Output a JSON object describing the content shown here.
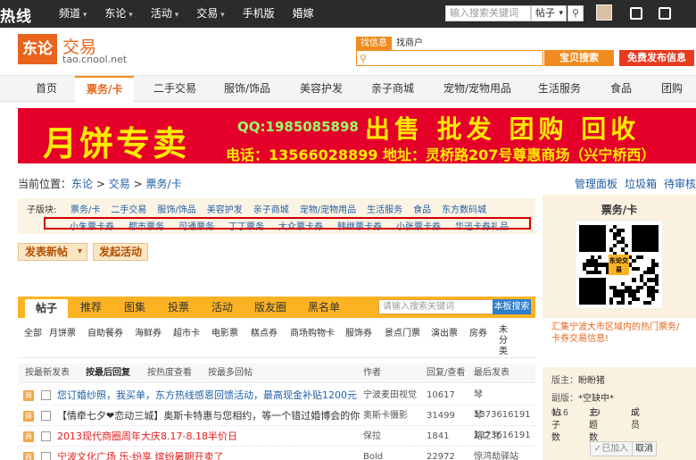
{
  "topbar": {
    "logo": "热线",
    "nav": [
      {
        "label": "频道",
        "dropdown": true
      },
      {
        "label": "东论",
        "dropdown": true
      },
      {
        "label": "活动",
        "dropdown": true
      },
      {
        "label": "交易",
        "dropdown": true
      },
      {
        "label": "手机版",
        "dropdown": false
      },
      {
        "label": "婚嫁",
        "dropdown": false
      }
    ],
    "search_placeholder": "输入搜索关键词",
    "search_type": "帖子"
  },
  "brand": {
    "logo_text": "东论",
    "title": "交易",
    "url": "tao.cnool.net"
  },
  "search": {
    "tabs": [
      "找信息",
      "找商户"
    ],
    "button": "宝贝搜索",
    "post_button": "免费发布信息"
  },
  "mainnav": [
    "首页",
    "票务/卡",
    "二手交易",
    "服饰/饰品",
    "美容护发",
    "亲子商城",
    "宠物/宠物用品",
    "生活服务",
    "食品",
    "团购"
  ],
  "banner": {
    "headline": "月饼专卖",
    "qq": "QQ:1985085898",
    "slogan": "出售 批发 团购 回收",
    "contact": "电话：13566028899 地址：灵桥路207号尊惠商场（兴宁桥西）"
  },
  "breadcrumb": {
    "prefix": "当前位置：",
    "items": [
      "东论",
      "交易",
      "票务/卡"
    ],
    "sep": ">"
  },
  "tools": [
    "管理面板",
    "垃圾箱",
    "待审核"
  ],
  "subboards": {
    "label": "子版块:",
    "row1": [
      "票务/卡",
      "二手交易",
      "服饰/饰品",
      "美容护发",
      "亲子商城",
      "宠物/宠物用品",
      "生活服务",
      "食品",
      "东方数码城"
    ],
    "row2": [
      "小朱票卡券",
      "都市票务",
      "司通票务",
      "丁丁票务",
      "大众票卡券",
      "韩继票卡券",
      "小张票卡券",
      "华迅卡券礼品"
    ]
  },
  "actions": {
    "new_post": "发表新帖",
    "new_activity": "发起活动"
  },
  "tabs": {
    "items": [
      "帖子",
      "推荐",
      "图集",
      "投票",
      "活动",
      "版友圈",
      "黑名单"
    ],
    "filter_placeholder": "请输入搜索关键词",
    "filter_button": "本板搜索"
  },
  "categories": [
    "全部",
    "月饼票",
    "自助餐券",
    "海鲜券",
    "超市卡",
    "电影票",
    "糕点券",
    "商场购物卡",
    "服饰券",
    "景点门票",
    "演出票",
    "房券"
  ],
  "categories_last": "未分类",
  "table": {
    "sort": [
      "按最新发表",
      "按最后回复",
      "按热度查看",
      "按最多回帖"
    ],
    "cols": [
      "作者",
      "回复/查看",
      "最后发表"
    ],
    "rows": [
      {
        "badge": "商",
        "title": "您订婚纱照，我买单，东方热线感恩回馈活动，最高现金补贴1200元",
        "color": "#1f5fa8",
        "author": "宁波麦田视觉",
        "count": "10617",
        "last": "琴1373616191"
      },
      {
        "badge": "商",
        "title": "【情牵七夕❤恋动三城】奥斯卡特惠与您相约，等一个错过婚博会的你",
        "color": "#333333",
        "author": "奥斯卡摄影",
        "count": "31499",
        "last": "琴1373616191"
      },
      {
        "badge": "商",
        "title": "2013现代商圈周年大庆8.17-8.18半价日",
        "color": "#e02020",
        "author": "保拉",
        "count": "1841",
        "last": "路之北"
      },
      {
        "badge": "商",
        "title": "宁波文化广场 乐·纷享 缤纷暑期开卖了",
        "color": "#e02020",
        "author": "Bold",
        "count": "22972",
        "last": "惊鸿劫驿站"
      }
    ]
  },
  "sidebar": {
    "title": "票务/卡",
    "qr_text": "东论交易",
    "desc": "汇集宁波大市区域内的热门票务/卡券交易信息!",
    "owner_label": "版主：",
    "owner": "盼盼猪",
    "deputy_label": "副版：",
    "deputy": "*空缺中*",
    "stats": [
      {
        "label": "帖子数",
        "value": "116"
      },
      {
        "label": "主题数",
        "value": "19"
      },
      {
        "label": "成员",
        "value": "5"
      }
    ],
    "joined": "已加入",
    "cancel": "取消"
  }
}
